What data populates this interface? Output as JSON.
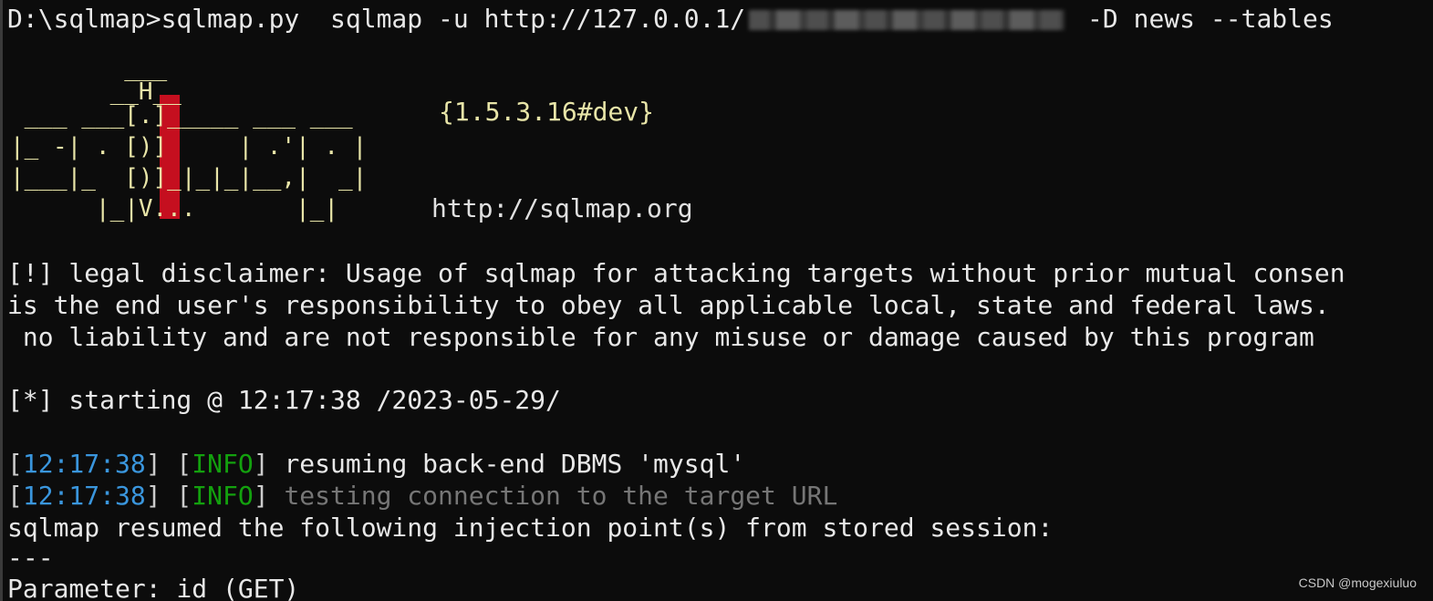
{
  "command": {
    "prompt": "D:\\sqlmap>sqlmap.py  sqlmap -u http://127.0.0.1/",
    "redacted": "redacted-url-segment",
    "args": " -D news --tables"
  },
  "banner": {
    "art": [
      "        ___",
      "       __H__",
      " ___ ___[.]_____ ___ ___",
      "|_ -| . [)]     | .'| . |",
      "|___|_  [)]_|_|_|__,|  _|",
      "      |_|V...       |_|"
    ],
    "version": "{1.5.3.16#dev}",
    "site": "http://sqlmap.org"
  },
  "disclaimer": [
    "[!] legal disclaimer: Usage of sqlmap for attacking targets without prior mutual consen",
    "is the end user's responsibility to obey all applicable local, state and federal laws. ",
    " no liability and are not responsible for any misuse or damage caused by this program"
  ],
  "starting": "[*] starting @ 12:17:38 /2023-05-29/",
  "logs": [
    {
      "open": "[",
      "time": "12:17:38",
      "mid": "] [",
      "level": "INFO",
      "close": "]",
      "message": " resuming back-end DBMS 'mysql'"
    },
    {
      "open": "[",
      "time": "12:17:38",
      "mid": "] [",
      "level": "INFO",
      "close": "]",
      "message": " testing connection to the target URL"
    }
  ],
  "resumed": "sqlmap resumed the following injection point(s) from stored session:",
  "separator": "---",
  "parameter": "Parameter: id (GET)",
  "watermark": "CSDN @mogexiuluo",
  "colors": {
    "background": "#0c0c0c",
    "timestamp": "#3a96dd",
    "info": "#13a10e",
    "banner": "#e8e5a8",
    "banner_highlight": "#c50f1f"
  }
}
